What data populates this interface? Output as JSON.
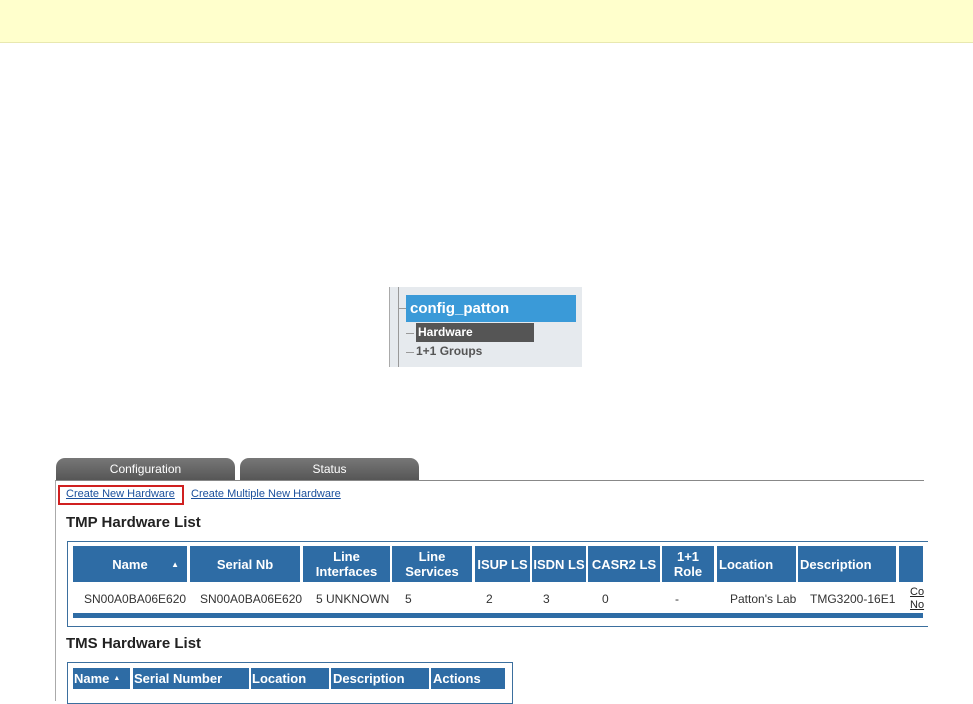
{
  "tree": {
    "root": "config_patton",
    "items": [
      "Hardware",
      "1+1 Groups"
    ]
  },
  "tabs": [
    "Configuration",
    "Status"
  ],
  "links": {
    "create_new": "Create New Hardware",
    "create_multiple": "Create Multiple New Hardware"
  },
  "tmp": {
    "title": "TMP Hardware List",
    "headers": [
      "Name",
      "Serial Nb",
      "Line Interfaces",
      "Line Services",
      "ISUP LS",
      "ISDN LS",
      "CASR2 LS",
      "1+1 Role",
      "Location",
      "Description",
      ""
    ],
    "rows": [
      {
        "name": "SN00A0BA06E620",
        "serial": "SN00A0BA06E620",
        "line_interfaces": "5 UNKNOWN",
        "line_services": "5",
        "isup": "2",
        "isdn": "3",
        "casr2": "0",
        "role": "-",
        "location": "Patton's Lab",
        "description": "TMG3200-16E1",
        "actions": [
          "Co",
          "No"
        ]
      }
    ]
  },
  "tms": {
    "title": "TMS Hardware List",
    "headers": [
      "Name",
      "Serial Number",
      "Location",
      "Description",
      "Actions"
    ]
  },
  "sort_icon": "triangle-up"
}
